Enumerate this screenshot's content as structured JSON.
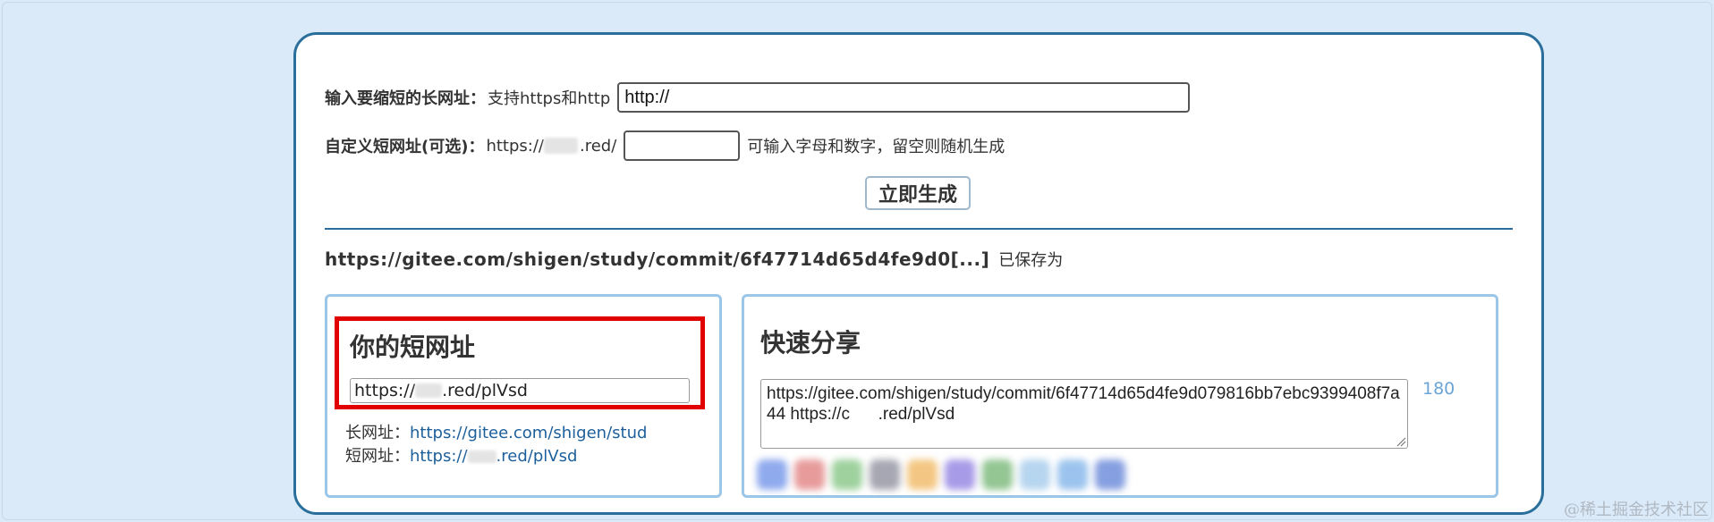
{
  "form": {
    "long_label": "输入要缩短的长网址",
    "long_colon": "：",
    "long_hint": "支持https和http",
    "long_value": "http://",
    "custom_label": "自定义短网址(可选)",
    "custom_colon": "：",
    "custom_prefix_start": "https://",
    "custom_prefix_end": ".red/",
    "custom_value": "",
    "custom_hint": "可输入字母和数字，留空则随机生成",
    "generate_label": "立即生成"
  },
  "result": {
    "saved_url": "https://gitee.com/shigen/study/commit/6f47714d65d4fe9d0[...]",
    "saved_tag": "已保存为"
  },
  "short_panel": {
    "title": "你的短网址",
    "short_start": "https://",
    "short_end": ".red/plVsd",
    "long_label": "长网址：",
    "long_link": "https://gitee.com/shigen/stud",
    "short_label": "短网址：",
    "short_link_start": "https://",
    "short_link_end": ".red/plVsd"
  },
  "share_panel": {
    "title": "快速分享",
    "text": "https://gitee.com/shigen/study/commit/6f47714d65d4fe9d079816bb7ebc9399408f7a44 https://c      .red/plVsd",
    "count": "180"
  },
  "colors": {
    "accent": "#2a6f9b",
    "highlight": "#e00000",
    "link": "#1c5f9a",
    "panel_border": "#9cc6e8"
  },
  "watermark": "@稀土掘金技术社区"
}
